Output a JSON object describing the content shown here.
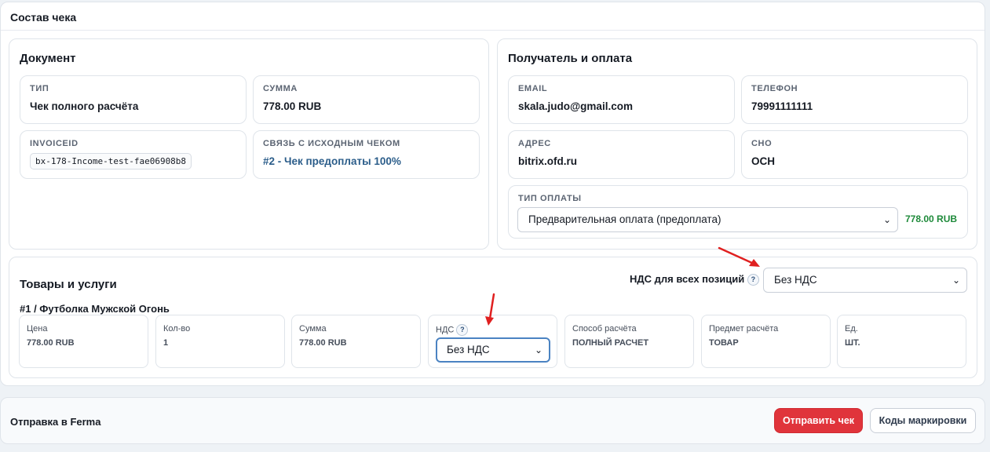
{
  "panel": {
    "title": "Состав чека"
  },
  "document": {
    "title": "Документ",
    "type": {
      "label": "ТИП",
      "value": "Чек полного расчёта"
    },
    "sum": {
      "label": "СУММА",
      "value": "778.00 RUB"
    },
    "invoice": {
      "label": "INVOICEID",
      "value": "bx-178-Income-test-fae06908b8"
    },
    "link": {
      "label": "СВЯЗЬ С ИСХОДНЫМ ЧЕКОМ",
      "value": "#2 - Чек предоплаты 100%"
    }
  },
  "recipient": {
    "title": "Получатель и оплата",
    "email": {
      "label": "EMAIL",
      "value": "skala.judo@gmail.com"
    },
    "phone": {
      "label": "ТЕЛЕФОН",
      "value": "79991111111"
    },
    "address": {
      "label": "АДРЕС",
      "value": "bitrix.ofd.ru"
    },
    "sno": {
      "label": "СНО",
      "value": "ОСН"
    },
    "payment": {
      "label": "ТИП ОПЛАТЫ",
      "selected": "Предварительная оплата (предоплата)",
      "amount": "778.00 RUB"
    }
  },
  "goods": {
    "title": "Товары и услуги",
    "vat_all": {
      "label": "НДС для всех позиций",
      "help": "?",
      "selected": "Без НДС"
    },
    "item": {
      "title": "#1 / Футболка Мужской Огонь",
      "price": {
        "label": "Цена",
        "value": "778.00 RUB"
      },
      "qty": {
        "label": "Кол-во",
        "value": "1"
      },
      "sum": {
        "label": "Сумма",
        "value": "778.00 RUB"
      },
      "vat": {
        "label": "НДС",
        "help": "?",
        "selected": "Без НДС"
      },
      "method": {
        "label": "Способ расчёта",
        "value": "ПОЛНЫЙ РАСЧЕТ"
      },
      "subject": {
        "label": "Предмет расчёта",
        "value": "ТОВАР"
      },
      "unit": {
        "label": "Ед.",
        "value": "ШТ."
      }
    }
  },
  "footer": {
    "title": "Отправка в Ferma",
    "send_label": "Отправить чек",
    "codes_label": "Коды маркировки"
  },
  "colors": {
    "accent_red": "#e0343b",
    "amount_green": "#1e8a3a",
    "link_blue": "#2b5d8a",
    "focus_blue": "#4b83c2"
  },
  "icons": [
    "chevron-down-icon",
    "help-icon",
    "red-arrow-annotation"
  ]
}
